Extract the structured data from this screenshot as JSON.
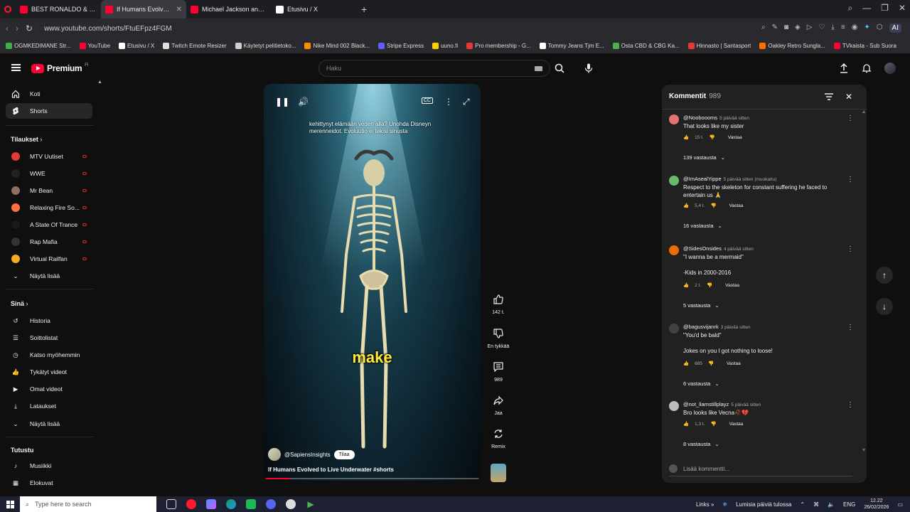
{
  "browser": {
    "tabs": [
      {
        "title": "BEST RONALDO & MESSI",
        "color": "#ff0033",
        "active": false
      },
      {
        "title": "If Humans Evolved to",
        "color": "#ff0033",
        "active": true
      },
      {
        "title": "Michael Jackson and Aar",
        "color": "#ff0033",
        "active": false
      },
      {
        "title": "Etusivu / X",
        "color": "#ffffff",
        "active": false
      }
    ],
    "url": "www.youtube.com/shorts/FtuEFpz4FGM",
    "ai_label": "AI",
    "bookmarks": [
      {
        "label": "OGMKEDIMANE Str...",
        "color": "#3cb043"
      },
      {
        "label": "YouTube",
        "color": "#ff0033"
      },
      {
        "label": "Etusivu / X",
        "color": "#ffffff"
      },
      {
        "label": "Twitch Emote Resizer",
        "color": "#e0e0e0"
      },
      {
        "label": "Käytetyt pelitietoko...",
        "color": "#cfcfcf"
      },
      {
        "label": "Nike Mind 002 Black...",
        "color": "#ff8c00"
      },
      {
        "label": "Stripe Express",
        "color": "#635bff"
      },
      {
        "label": "uuno.fi",
        "color": "#ffcc00"
      },
      {
        "label": "Pro membership - G...",
        "color": "#e53935"
      },
      {
        "label": "Tommy Jeans Tjm E...",
        "color": "#ffffff"
      },
      {
        "label": "Osta CBD & CBG Ka...",
        "color": "#4caf50"
      },
      {
        "label": "Hinnasto | Santasport",
        "color": "#e53935"
      },
      {
        "label": "Oakley Retro Sungla...",
        "color": "#ff6f00"
      },
      {
        "label": "TVkaista - Sub Suora",
        "color": "#ff0033"
      }
    ]
  },
  "header": {
    "logo": "Premium",
    "logo_sup": "FI",
    "search_placeholder": "Haku"
  },
  "sidebar": {
    "home": "Koti",
    "shorts": "Shorts",
    "subscriptions_title": "Tilaukset",
    "channels": [
      {
        "name": "MTV Uutiset",
        "color": "#e53935"
      },
      {
        "name": "WWE",
        "color": "#222222"
      },
      {
        "name": "Mr Bean",
        "color": "#8d6e63"
      },
      {
        "name": "Relaxing Fire So...",
        "color": "#ff7043"
      },
      {
        "name": "A State Of Trance",
        "color": "#1a1a1a"
      },
      {
        "name": "Rap Mafia",
        "color": "#333333"
      },
      {
        "name": "Virtual Railfan",
        "color": "#f9a825"
      }
    ],
    "show_more": "Näytä lisää",
    "you_title": "Sinä",
    "you_items": [
      {
        "label": "Historia",
        "icon": "history-icon"
      },
      {
        "label": "Soittolistat",
        "icon": "playlist-icon"
      },
      {
        "label": "Katso myöhemmin",
        "icon": "clock-icon"
      },
      {
        "label": "Tykätyt videot",
        "icon": "thumbs-up-icon"
      },
      {
        "label": "Omat videot",
        "icon": "video-icon"
      },
      {
        "label": "Lataukset",
        "icon": "download-icon"
      }
    ],
    "show_more_2": "Näytä lisää",
    "explore_title": "Tutustu",
    "explore_items": [
      {
        "label": "Musiikki",
        "icon": "music-icon"
      },
      {
        "label": "Elokuvat",
        "icon": "film-icon"
      }
    ]
  },
  "video": {
    "caption": "kehittynyt elämään veden alla? Unohda Disneyn merenneidot. Evoluutio ei tekisi sinusta",
    "subtitle": "make",
    "channel": "@SapiensInsights",
    "subscribe": "Tilaa",
    "title": "If Humans Evolved to Live Underwater #shorts",
    "progress": 0.12
  },
  "actions": {
    "like_count": "142 t.",
    "dislike_label": "En tykkää",
    "comment_count": "989",
    "share_label": "Jaa",
    "remix_label": "Remix"
  },
  "comments": {
    "title": "Kommentit",
    "count": "989",
    "add_placeholder": "Lisää kommentti...",
    "items": [
      {
        "user": "@Nooboooms",
        "time": "5 päivää sitten",
        "text": "That looks like my sister",
        "likes": "15 t.",
        "reply": "Vastaa",
        "replies": "139 vastausta",
        "color": "#e57373"
      },
      {
        "user": "@ImAsealYippe",
        "time": "5 päivää sitten (muokattu)",
        "text": "Respect to the skeleton for constant suffering he faced to entertain us 🙏",
        "likes": "5,4 t.",
        "reply": "Vastaa",
        "replies": "16 vastausta",
        "color": "#66bb6a"
      },
      {
        "user": "@SidesOnsides",
        "time": "4 päivää sitten",
        "text": "\"I wanna be a mermaid\"\n\n-Kids in 2000-2016",
        "likes": "2 t.",
        "reply": "Vastaa",
        "replies": "5 vastausta",
        "color": "#ef6c00"
      },
      {
        "user": "@bagusvijanrk",
        "time": "3 päivää sitten",
        "text": "\"You'd be bald\"\n\nJokes on you I got nothing to loose!",
        "likes": "685",
        "reply": "Vastaa",
        "replies": "6 vastausta",
        "color": "#424242"
      },
      {
        "user": "@not_liamstillplayz",
        "time": "5 päivää sitten",
        "text": "Bro looks like Vecna🥀💔",
        "likes": "1,3 t.",
        "reply": "Vastaa",
        "replies": "8 vastausta",
        "color": "#bdbdbd"
      }
    ]
  },
  "taskbar": {
    "search": "Type here to search",
    "links": "Links",
    "weather": "Lumisia päiviä tulossa",
    "lang": "ENG",
    "time": "12.22",
    "date": "26/02/2026"
  }
}
